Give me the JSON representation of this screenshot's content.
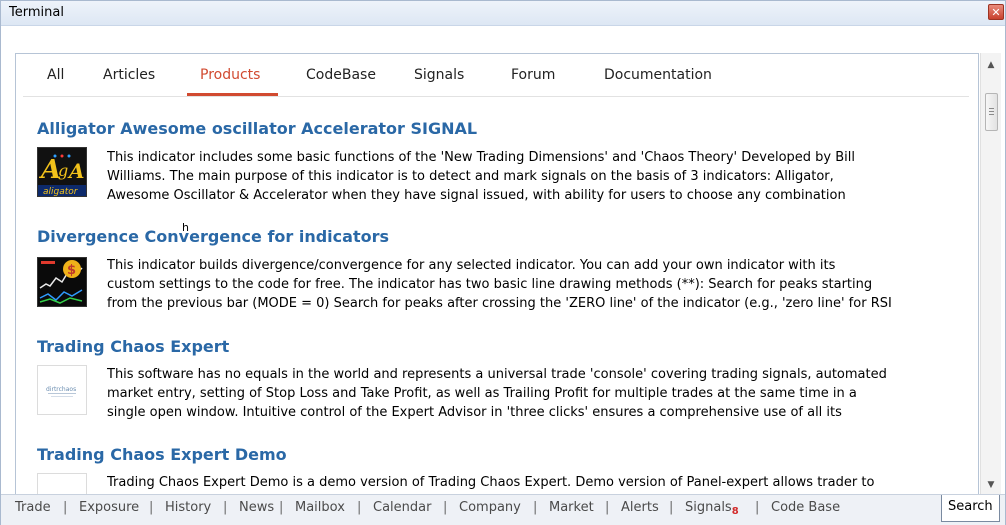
{
  "window": {
    "title": "Terminal",
    "close_glyph": "✕"
  },
  "nav": {
    "tabs": [
      {
        "label": "All"
      },
      {
        "label": "Articles"
      },
      {
        "label": "Products"
      },
      {
        "label": "CodeBase"
      },
      {
        "label": "Signals"
      },
      {
        "label": "Forum"
      },
      {
        "label": "Documentation"
      }
    ],
    "active": "Products"
  },
  "products": [
    {
      "title": "Alligator Awesome oscillator Accelerator SIGNAL",
      "icon": "alligator-indicator-icon",
      "lines": [
        "This indicator includes some basic functions of the 'New Trading Dimensions' and 'Chaos Theory' Developed by Bill",
        "Williams. The main purpose of this indicator is to detect and mark signals on the basis of 3 indicators: Alligator,",
        "Awesome Oscillator & Accelerator when they have signal issued, with ability for users to choose any combination"
      ]
    },
    {
      "title": "Divergence Convergence for indicators",
      "icon": "divergence-chart-icon",
      "lines": [
        "This indicator builds divergence/convergence for any selected indicator. You can add your own indicator with its",
        "custom settings to the code for free. The indicator has two basic line drawing methods (**): Search for peaks starting",
        "from the previous bar (MODE = 0) Search for peaks after crossing the 'ZERO line' of the indicator (e.g., 'zero line' for RSI"
      ]
    },
    {
      "title": "Trading Chaos Expert",
      "icon": "trading-chaos-logo-icon",
      "lines": [
        "This software has no equals in the world and represents a universal trade 'console' covering trading signals, automated",
        "market entry, setting of Stop Loss and Take Profit, as well as Trailing Profit for multiple trades at the same time in a",
        "single open window. Intuitive control of the Expert Advisor in 'three clicks' ensures a comprehensive use of all its"
      ]
    },
    {
      "title": "Trading Chaos Expert Demo",
      "icon": "",
      "lines": [
        "Trading Chaos Expert Demo is a demo version of Trading Chaos Expert. Demo version of Panel-expert allows trader to"
      ]
    }
  ],
  "cursor_char": "h",
  "bottom_tabs": [
    {
      "label": "Trade"
    },
    {
      "label": "Exposure"
    },
    {
      "label": "History"
    },
    {
      "label": "News"
    },
    {
      "label": "Mailbox"
    },
    {
      "label": "Calendar"
    },
    {
      "label": "Company"
    },
    {
      "label": "Market"
    },
    {
      "label": "Alerts"
    },
    {
      "label": "Signals",
      "badge": "8"
    },
    {
      "label": "Code Base"
    },
    {
      "label": "Search"
    }
  ],
  "bottom_active": "Search",
  "colors": {
    "accent": "#d14a30",
    "link": "#2a68a6",
    "badge": "#d22a2a"
  }
}
